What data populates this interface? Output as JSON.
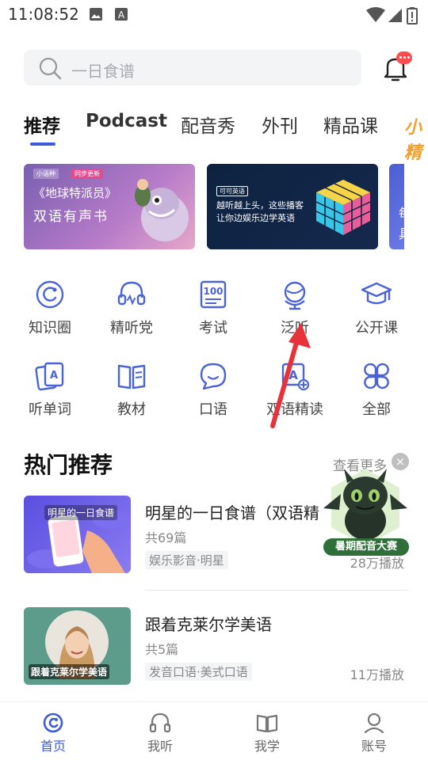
{
  "status_bar": {
    "time": "11:08:52"
  },
  "search": {
    "placeholder": "一日食谱"
  },
  "tabs": [
    {
      "label": "推荐",
      "active": true
    },
    {
      "label": "Podcast"
    },
    {
      "label": "配音秀"
    },
    {
      "label": "外刊"
    },
    {
      "label": "精品课"
    }
  ],
  "tab_promo": "小精",
  "banners": [
    {
      "tag1": "小语种",
      "tag2": "同步更新",
      "title": "《地球特派员》",
      "subtitle": "双语有声书"
    },
    {
      "tag": "可可英语",
      "line1": "越听越上头，这些播客",
      "line2": "让你边娱乐边学英语"
    },
    {
      "text": "每\n具"
    }
  ],
  "grid": [
    {
      "label": "知识圈",
      "icon": "circle-refresh-icon"
    },
    {
      "label": "精听党",
      "icon": "headset-icon"
    },
    {
      "label": "考试",
      "icon": "score-100-icon"
    },
    {
      "label": "泛听",
      "icon": "globe-icon"
    },
    {
      "label": "公开课",
      "icon": "graduation-cap-icon"
    },
    {
      "label": "听单词",
      "icon": "word-card-icon"
    },
    {
      "label": "教材",
      "icon": "book-icon"
    },
    {
      "label": "口语",
      "icon": "speech-bubble-icon"
    },
    {
      "label": "双语精读",
      "icon": "translate-icon"
    },
    {
      "label": "全部",
      "icon": "four-petal-icon"
    }
  ],
  "section": {
    "title": "热门推荐",
    "more": "查看更多"
  },
  "cards": [
    {
      "thumb_text": "明星的一日食谱",
      "title": "明星的一日食谱（双语精",
      "count": "共69篇",
      "tag": "娱乐影音·明星",
      "plays": "28万播放"
    },
    {
      "thumb_text": "跟着克莱尔学美语",
      "title": "跟着克莱尔学美语",
      "count": "共5篇",
      "tag": "发音口语·美式口语",
      "plays": "11万播放"
    }
  ],
  "float_ad": {
    "label": "暑期配音大赛",
    "close": "×"
  },
  "bottom_nav": [
    {
      "label": "首页",
      "active": true
    },
    {
      "label": "我听"
    },
    {
      "label": "我学"
    },
    {
      "label": "账号"
    }
  ],
  "colors": {
    "accent": "#3b5bdb",
    "promo": "#f2a02c",
    "badge": "#ff4d4f"
  }
}
